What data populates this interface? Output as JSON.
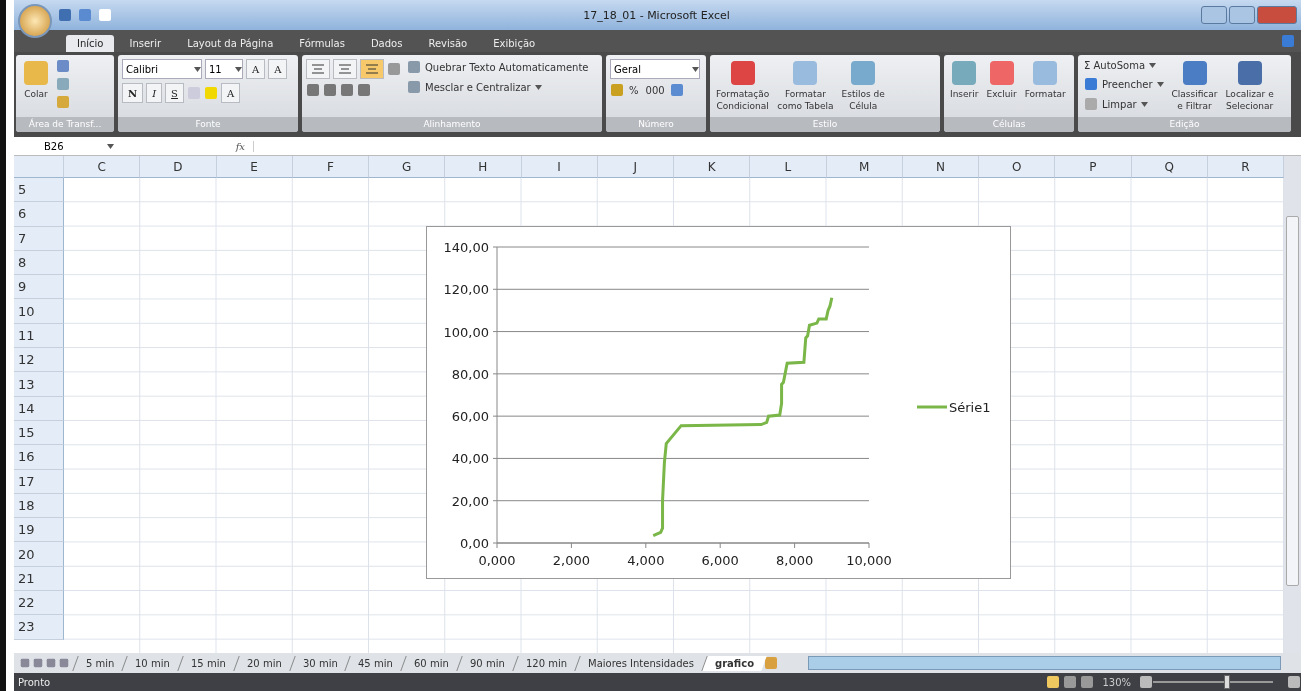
{
  "window": {
    "title": "17_18_01 - Microsoft Excel"
  },
  "ribbon_tabs": [
    {
      "label": "Início",
      "selected": true
    },
    {
      "label": "Inserir",
      "selected": false
    },
    {
      "label": "Layout da Página",
      "selected": false
    },
    {
      "label": "Fórmulas",
      "selected": false
    },
    {
      "label": "Dados",
      "selected": false
    },
    {
      "label": "Revisão",
      "selected": false
    },
    {
      "label": "Exibição",
      "selected": false
    }
  ],
  "clipboard": {
    "paste": "Colar",
    "group": "Área de Transf..."
  },
  "font": {
    "name": "Calibri",
    "size": "11",
    "grow": "A",
    "shrink": "A",
    "bold": "N",
    "italic": "I",
    "underline": "S",
    "color_letter": "A",
    "group": "Fonte"
  },
  "alignment": {
    "align_buttons": [
      {
        "selected": false
      },
      {
        "selected": false
      },
      {
        "selected": true
      }
    ],
    "wrap": "Quebrar Texto Automaticamente",
    "merge": "Mesclar e Centralizar",
    "group": "Alinhamento"
  },
  "number": {
    "format": "Geral",
    "percent": "%",
    "thousands": "000",
    "group": "Número"
  },
  "styles": {
    "buttons": [
      {
        "line1": "Formatação",
        "line2": "Condicional"
      },
      {
        "line1": "Formatar",
        "line2": "como Tabela"
      },
      {
        "line1": "Estilos de",
        "line2": "Célula"
      }
    ],
    "group": "Estilo"
  },
  "cells": {
    "buttons": [
      "Inserir",
      "Excluir",
      "Formatar"
    ],
    "group": "Células"
  },
  "editing": {
    "sigma": "Σ",
    "autosum": "AutoSoma",
    "fill": "Preencher",
    "clear": "Limpar",
    "sort": {
      "line1": "Classificar",
      "line2": "e Filtrar"
    },
    "find": {
      "line1": "Localizar e",
      "line2": "Selecionar"
    },
    "group": "Edição"
  },
  "formula_bar": {
    "name_box": "B26",
    "fx": "fx"
  },
  "columns": [
    "C",
    "D",
    "E",
    "F",
    "G",
    "H",
    "I",
    "J",
    "K",
    "L",
    "M",
    "N",
    "O",
    "P",
    "Q",
    "R"
  ],
  "rows": [
    "5",
    "6",
    "7",
    "8",
    "9",
    "10",
    "11",
    "12",
    "13",
    "14",
    "15",
    "16",
    "17",
    "18",
    "19",
    "20",
    "21",
    "22",
    "23"
  ],
  "chart": {
    "chart_data": {
      "type": "line",
      "grid": true,
      "xlim": [
        0,
        10
      ],
      "ylim": [
        0,
        140
      ],
      "xticks": [
        {
          "value": 0,
          "label": "0,000"
        },
        {
          "value": 2,
          "label": "2,000"
        },
        {
          "value": 4,
          "label": "4,000"
        },
        {
          "value": 6,
          "label": "6,000"
        },
        {
          "value": 8,
          "label": "8,000"
        },
        {
          "value": 10,
          "label": "10,000"
        }
      ],
      "yticks": [
        {
          "value": 0,
          "label": "0,00"
        },
        {
          "value": 20,
          "label": "20,00"
        },
        {
          "value": 40,
          "label": "40,00"
        },
        {
          "value": 60,
          "label": "60,00"
        },
        {
          "value": 80,
          "label": "80,00"
        },
        {
          "value": 100,
          "label": "100,00"
        },
        {
          "value": 120,
          "label": "120,00"
        },
        {
          "value": 140,
          "label": "140,00"
        }
      ],
      "x": [
        4.2,
        4.4,
        4.45,
        4.45,
        4.5,
        4.55,
        4.95,
        7.1,
        7.25,
        7.3,
        7.6,
        7.65,
        7.65,
        7.7,
        7.8,
        8.25,
        8.3,
        8.35,
        8.4,
        8.6,
        8.65,
        8.85,
        8.9,
        8.95,
        9.0
      ],
      "series": [
        {
          "name": "Série1",
          "color": "#7ab648",
          "values": [
            3.5,
            5,
            7,
            20,
            38,
            47,
            55.5,
            56,
            57,
            60,
            60.5,
            66,
            75,
            76,
            85,
            85.5,
            97,
            98,
            103,
            104,
            106,
            106,
            110,
            112,
            116
          ]
        }
      ]
    }
  },
  "sheet_tabs": [
    {
      "label": "5 min",
      "selected": false
    },
    {
      "label": "10 min",
      "selected": false
    },
    {
      "label": "15 min",
      "selected": false
    },
    {
      "label": "20 min",
      "selected": false
    },
    {
      "label": "30 min",
      "selected": false
    },
    {
      "label": "45 min",
      "selected": false
    },
    {
      "label": "60 min",
      "selected": false
    },
    {
      "label": "90 min",
      "selected": false
    },
    {
      "label": "120 min",
      "selected": false
    },
    {
      "label": "Maiores Intensidades",
      "selected": false
    },
    {
      "label": "grafico",
      "selected": true
    }
  ],
  "status_bar": {
    "status": "Pronto",
    "zoom": "130%",
    "zoom_slider": {
      "level": 0.62
    }
  }
}
